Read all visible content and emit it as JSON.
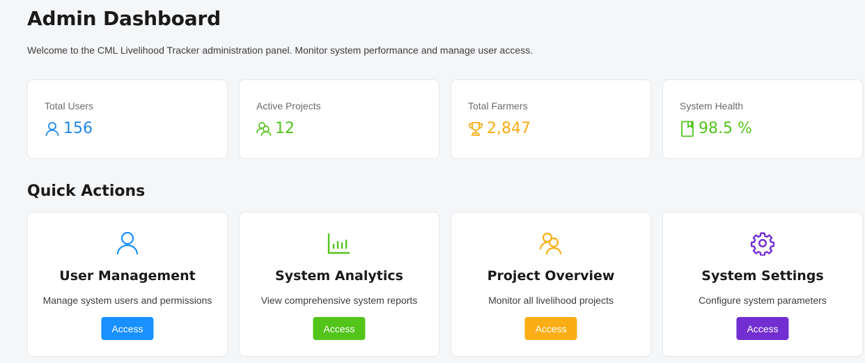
{
  "header": {
    "title": "Admin Dashboard",
    "subtitle": "Welcome to the CML Livelihood Tracker administration panel. Monitor system performance and manage user access."
  },
  "stats": [
    {
      "label": "Total Users",
      "value": "156",
      "icon": "user-icon",
      "color": "#1e88e5"
    },
    {
      "label": "Active Projects",
      "value": "12",
      "icon": "team-icon",
      "color": "#52c41a"
    },
    {
      "label": "Total Farmers",
      "value": "2,847",
      "icon": "trophy-icon",
      "color": "#faad14"
    },
    {
      "label": "System Health",
      "value": "98.5 %",
      "icon": "book-icon",
      "color": "#52c41a"
    }
  ],
  "quick_actions": {
    "title": "Quick Actions",
    "items": [
      {
        "title": "User Management",
        "description": "Manage system users and permissions",
        "button": "Access",
        "icon": "user-icon",
        "color": "#1890ff"
      },
      {
        "title": "System Analytics",
        "description": "View comprehensive system reports",
        "button": "Access",
        "icon": "bar-chart-icon",
        "color": "#52c41a"
      },
      {
        "title": "Project Overview",
        "description": "Monitor all livelihood projects",
        "button": "Access",
        "icon": "team-icon",
        "color": "#faad14"
      },
      {
        "title": "System Settings",
        "description": "Configure system parameters",
        "button": "Access",
        "icon": "gear-icon",
        "color": "#722ed1"
      }
    ]
  }
}
